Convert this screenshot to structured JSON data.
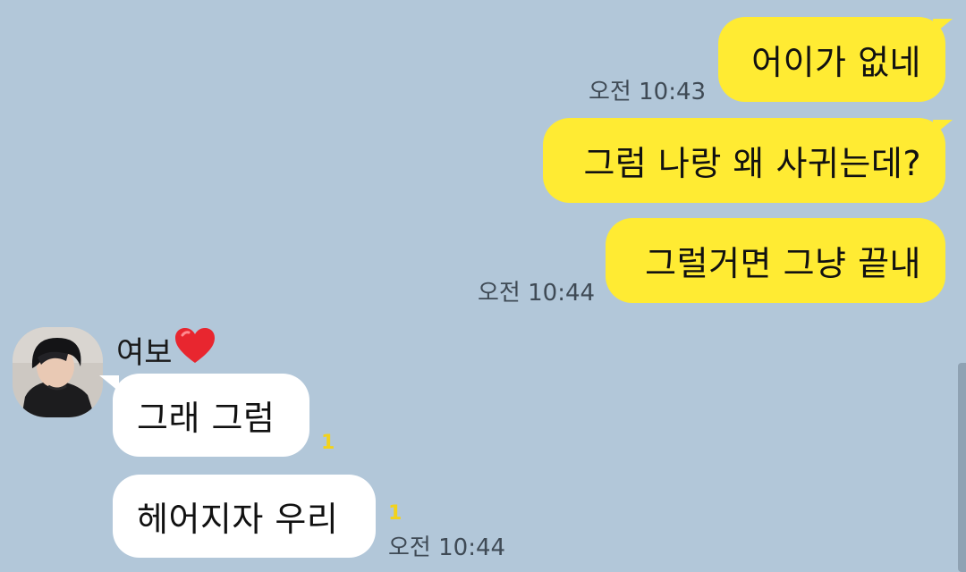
{
  "messages_outgoing": [
    {
      "text": "어이가 없네"
    },
    {
      "text": "그럼 나랑 왜 사귀는데?"
    },
    {
      "text": "그럴거면 그냥 끝내"
    }
  ],
  "outgoing_times": [
    "오전 10:43",
    "오전 10:44"
  ],
  "sender": {
    "name": "여보",
    "name_emoji": "heart-icon"
  },
  "messages_incoming": [
    {
      "text": "그래 그럼",
      "unread": "1"
    },
    {
      "text": "헤어지자 우리",
      "unread": "1"
    }
  ],
  "incoming_time": "오전 10:44",
  "colors": {
    "background": "#b2c7d9",
    "outgoing_bubble": "#ffeb33",
    "incoming_bubble": "#ffffff",
    "unread_count": "#f2d21c",
    "heart": "#e8262f"
  }
}
